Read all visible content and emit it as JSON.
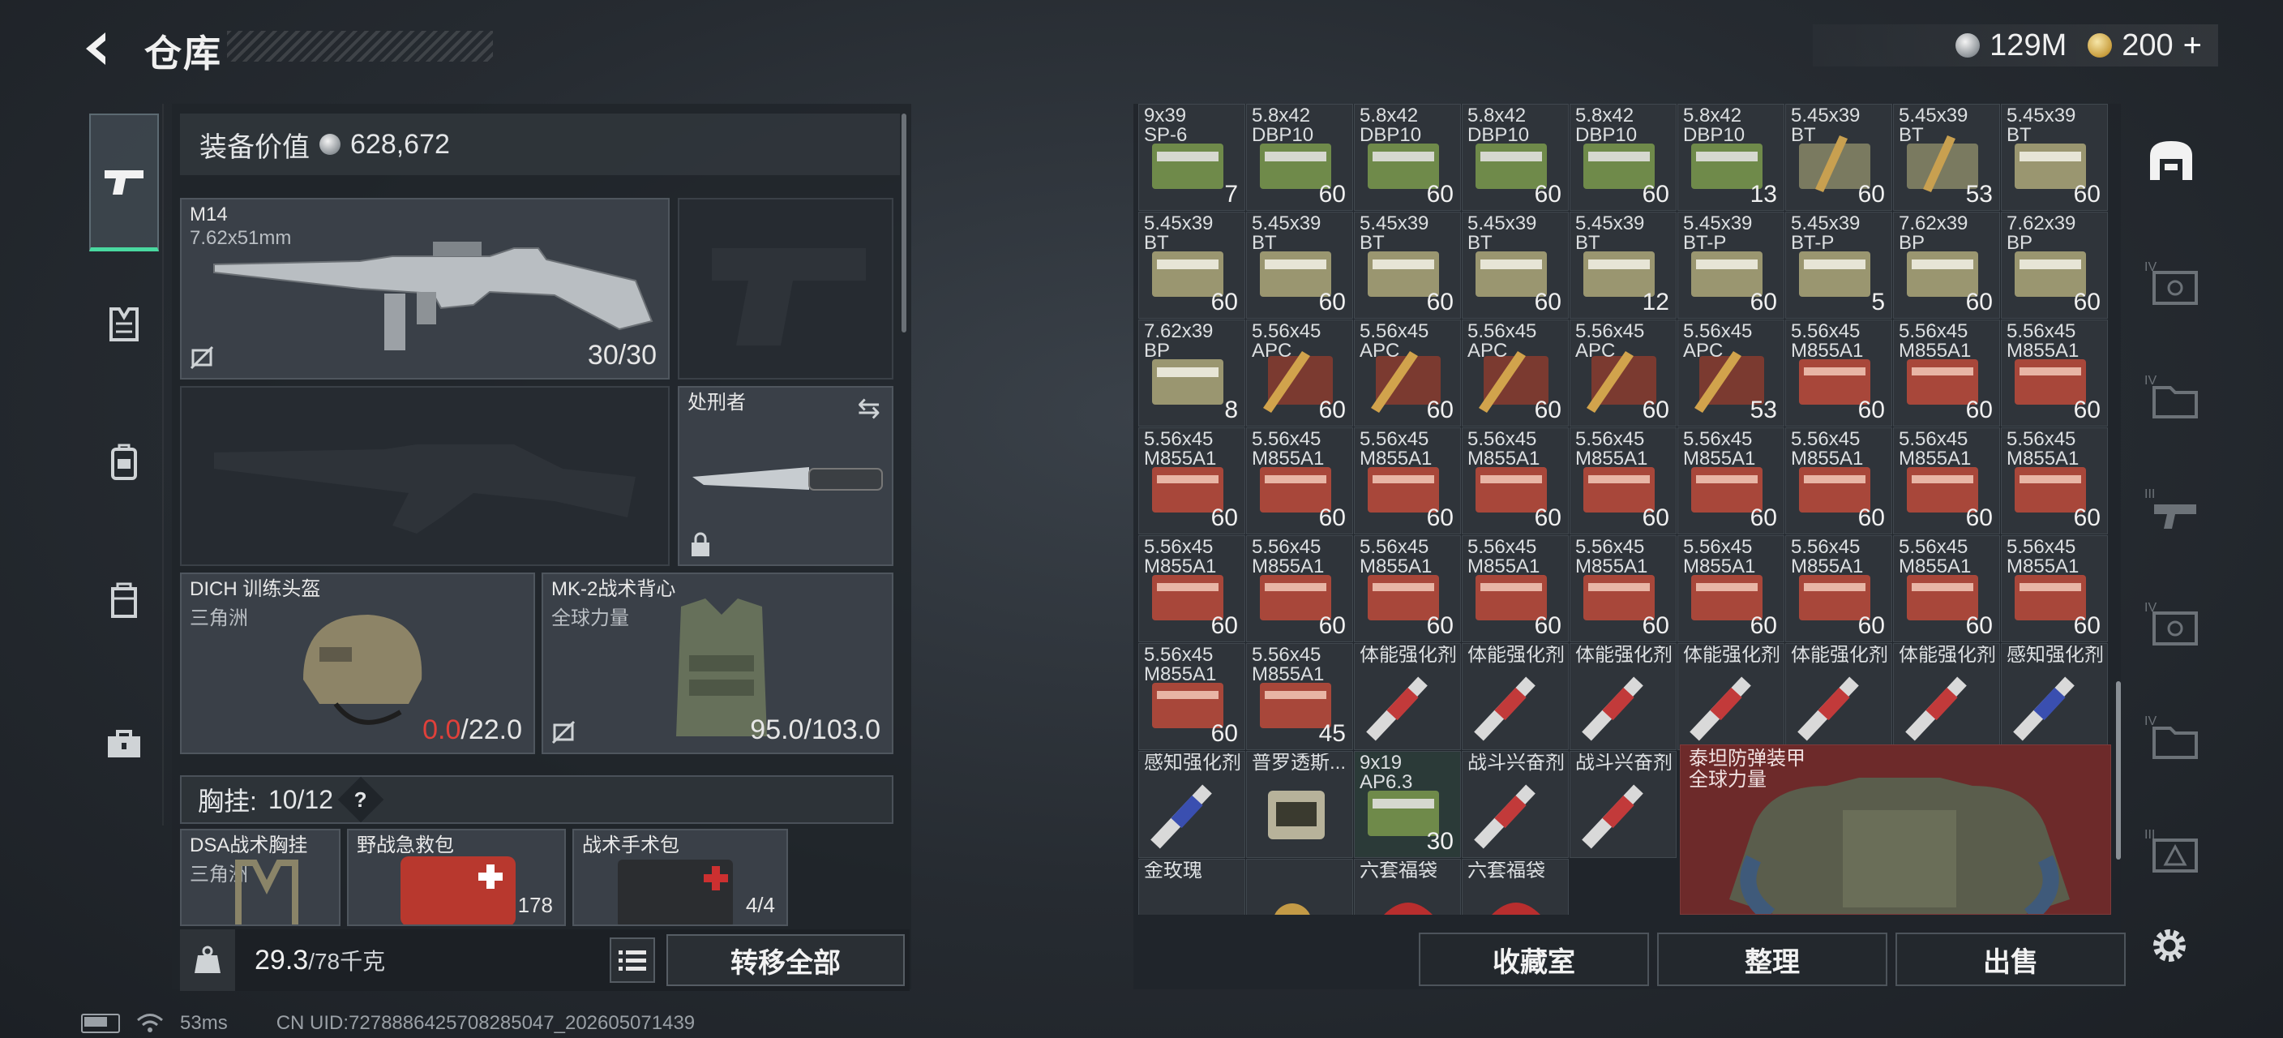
{
  "header": {
    "title": "仓库",
    "currency": [
      {
        "icon": "silver-coin-icon",
        "value": "129M"
      },
      {
        "icon": "gold-coin-icon",
        "value": "200"
      }
    ]
  },
  "equipment": {
    "value_label": "装备价值",
    "value": "628,672",
    "primary_weapon": {
      "name": "M14",
      "caliber": "7.62x51mm",
      "ammo": "30/30"
    },
    "melee": {
      "name": "处刑者"
    },
    "helmet": {
      "name": "DICH 训练头盔",
      "sub": "三角洲",
      "durability_current": "0.0",
      "durability_max": "/22.0"
    },
    "armor": {
      "name": "MK-2战术背心",
      "sub": "全球力量",
      "durability": "95.0/103.0"
    },
    "chest_rig_label": "胸挂:",
    "chest_rig_capacity": "10/12",
    "chest_items": [
      {
        "name": "DSA战术胸挂",
        "sub": "三角洲",
        "count": ""
      },
      {
        "name": "野战急救包",
        "sub": "",
        "count": "178"
      },
      {
        "name": "战术手术包",
        "sub": "",
        "count": "4/4"
      }
    ],
    "weight_current": "29.3",
    "weight_max": "/78千克",
    "transfer_all": "转移全部"
  },
  "storage": {
    "rows": [
      [
        {
          "name": "9x39\nSP-6",
          "count": "7",
          "type": "ammo-green"
        },
        {
          "name": "5.8x42\nDBP10",
          "count": "60",
          "type": "ammo-green"
        },
        {
          "name": "5.8x42\nDBP10",
          "count": "60",
          "type": "ammo-green"
        },
        {
          "name": "5.8x42\nDBP10",
          "count": "60",
          "type": "ammo-green"
        },
        {
          "name": "5.8x42\nDBP10",
          "count": "60",
          "type": "ammo-green"
        },
        {
          "name": "5.8x42\nDBP10",
          "count": "13",
          "type": "ammo-green"
        },
        {
          "name": "5.45x39\nBT",
          "count": "60",
          "type": "ammo-bullets"
        },
        {
          "name": "5.45x39\nBT",
          "count": "53",
          "type": "ammo-bullets"
        },
        {
          "name": "5.45x39\nBT",
          "count": "60",
          "type": "ammo-olive"
        }
      ],
      [
        {
          "name": "5.45x39\nBT",
          "count": "60",
          "type": "ammo-olive"
        },
        {
          "name": "5.45x39\nBT",
          "count": "60",
          "type": "ammo-olive"
        },
        {
          "name": "5.45x39\nBT",
          "count": "60",
          "type": "ammo-olive"
        },
        {
          "name": "5.45x39\nBT",
          "count": "60",
          "type": "ammo-olive"
        },
        {
          "name": "5.45x39\nBT",
          "count": "12",
          "type": "ammo-olive"
        },
        {
          "name": "5.45x39\nBT-P",
          "count": "60",
          "type": "ammo-olive"
        },
        {
          "name": "5.45x39\nBT-P",
          "count": "5",
          "type": "ammo-olive"
        },
        {
          "name": "7.62x39\nBP",
          "count": "60",
          "type": "ammo-olive"
        },
        {
          "name": "7.62x39\nBP",
          "count": "60",
          "type": "ammo-olive"
        }
      ],
      [
        {
          "name": "7.62x39\nBP",
          "count": "8",
          "type": "ammo-olive"
        },
        {
          "name": "5.56x45\nAPC",
          "count": "60",
          "type": "ammo-apc"
        },
        {
          "name": "5.56x45\nAPC",
          "count": "60",
          "type": "ammo-apc"
        },
        {
          "name": "5.56x45\nAPC",
          "count": "60",
          "type": "ammo-apc"
        },
        {
          "name": "5.56x45\nAPC",
          "count": "60",
          "type": "ammo-apc"
        },
        {
          "name": "5.56x45\nAPC",
          "count": "53",
          "type": "ammo-apc"
        },
        {
          "name": "5.56x45\nM855A1",
          "count": "60",
          "type": "ammo-red"
        },
        {
          "name": "5.56x45\nM855A1",
          "count": "60",
          "type": "ammo-red"
        },
        {
          "name": "5.56x45\nM855A1",
          "count": "60",
          "type": "ammo-red"
        }
      ],
      [
        {
          "name": "5.56x45\nM855A1",
          "count": "60",
          "type": "ammo-red"
        },
        {
          "name": "5.56x45\nM855A1",
          "count": "60",
          "type": "ammo-red"
        },
        {
          "name": "5.56x45\nM855A1",
          "count": "60",
          "type": "ammo-red"
        },
        {
          "name": "5.56x45\nM855A1",
          "count": "60",
          "type": "ammo-red"
        },
        {
          "name": "5.56x45\nM855A1",
          "count": "60",
          "type": "ammo-red"
        },
        {
          "name": "5.56x45\nM855A1",
          "count": "60",
          "type": "ammo-red"
        },
        {
          "name": "5.56x45\nM855A1",
          "count": "60",
          "type": "ammo-red"
        },
        {
          "name": "5.56x45\nM855A1",
          "count": "60",
          "type": "ammo-red"
        },
        {
          "name": "5.56x45\nM855A1",
          "count": "60",
          "type": "ammo-red"
        }
      ],
      [
        {
          "name": "5.56x45\nM855A1",
          "count": "60",
          "type": "ammo-red"
        },
        {
          "name": "5.56x45\nM855A1",
          "count": "60",
          "type": "ammo-red"
        },
        {
          "name": "5.56x45\nM855A1",
          "count": "60",
          "type": "ammo-red"
        },
        {
          "name": "5.56x45\nM855A1",
          "count": "60",
          "type": "ammo-red"
        },
        {
          "name": "5.56x45\nM855A1",
          "count": "60",
          "type": "ammo-red"
        },
        {
          "name": "5.56x45\nM855A1",
          "count": "60",
          "type": "ammo-red"
        },
        {
          "name": "5.56x45\nM855A1",
          "count": "60",
          "type": "ammo-red"
        },
        {
          "name": "5.56x45\nM855A1",
          "count": "60",
          "type": "ammo-red"
        },
        {
          "name": "5.56x45\nM855A1",
          "count": "60",
          "type": "ammo-red"
        }
      ],
      [
        {
          "name": "5.56x45\nM855A1",
          "count": "60",
          "type": "ammo-red"
        },
        {
          "name": "5.56x45\nM855A1",
          "count": "45",
          "type": "ammo-red"
        },
        {
          "name": "体能强化剂",
          "count": "",
          "type": "syringe-red"
        },
        {
          "name": "体能强化剂",
          "count": "",
          "type": "syringe-red"
        },
        {
          "name": "体能强化剂",
          "count": "",
          "type": "syringe-red"
        },
        {
          "name": "体能强化剂",
          "count": "",
          "type": "syringe-red"
        },
        {
          "name": "体能强化剂",
          "count": "",
          "type": "syringe-red"
        },
        {
          "name": "体能强化剂",
          "count": "",
          "type": "syringe-red"
        },
        {
          "name": "感知强化剂",
          "count": "",
          "type": "syringe-blue"
        }
      ],
      [
        {
          "name": "感知强化剂",
          "count": "",
          "type": "syringe-blue"
        },
        {
          "name": "普罗透斯...",
          "count": "",
          "type": "pack"
        },
        {
          "name": "9x19\nAP6.3",
          "count": "30",
          "type": "ammo-green"
        },
        {
          "name": "战斗兴奋剂",
          "count": "",
          "type": "syringe-red"
        },
        {
          "name": "战斗兴奋剂",
          "count": "",
          "type": "syringe-red"
        }
      ],
      [
        {
          "name": "金玫瑰",
          "count": "",
          "type": "rose"
        },
        {
          "name": "",
          "count": "",
          "type": "rose2"
        },
        {
          "name": "六套福袋",
          "count": "",
          "type": "bag"
        },
        {
          "name": "六套福袋",
          "count": "",
          "type": "bag"
        }
      ]
    ],
    "big_item": {
      "name": "泰坦防弹装甲",
      "sub": "全球力量"
    },
    "buttons": {
      "collection": "收藏室",
      "sort": "整理",
      "sell": "出售"
    }
  },
  "status_bar": {
    "ping": "53ms",
    "uid": "CN UID:7278886425708285047_202605071439"
  },
  "colors": {
    "accent_green": "#49d9a0",
    "durability_red": "#e0403a",
    "ammo_red_bg": "#6d2a2a"
  }
}
